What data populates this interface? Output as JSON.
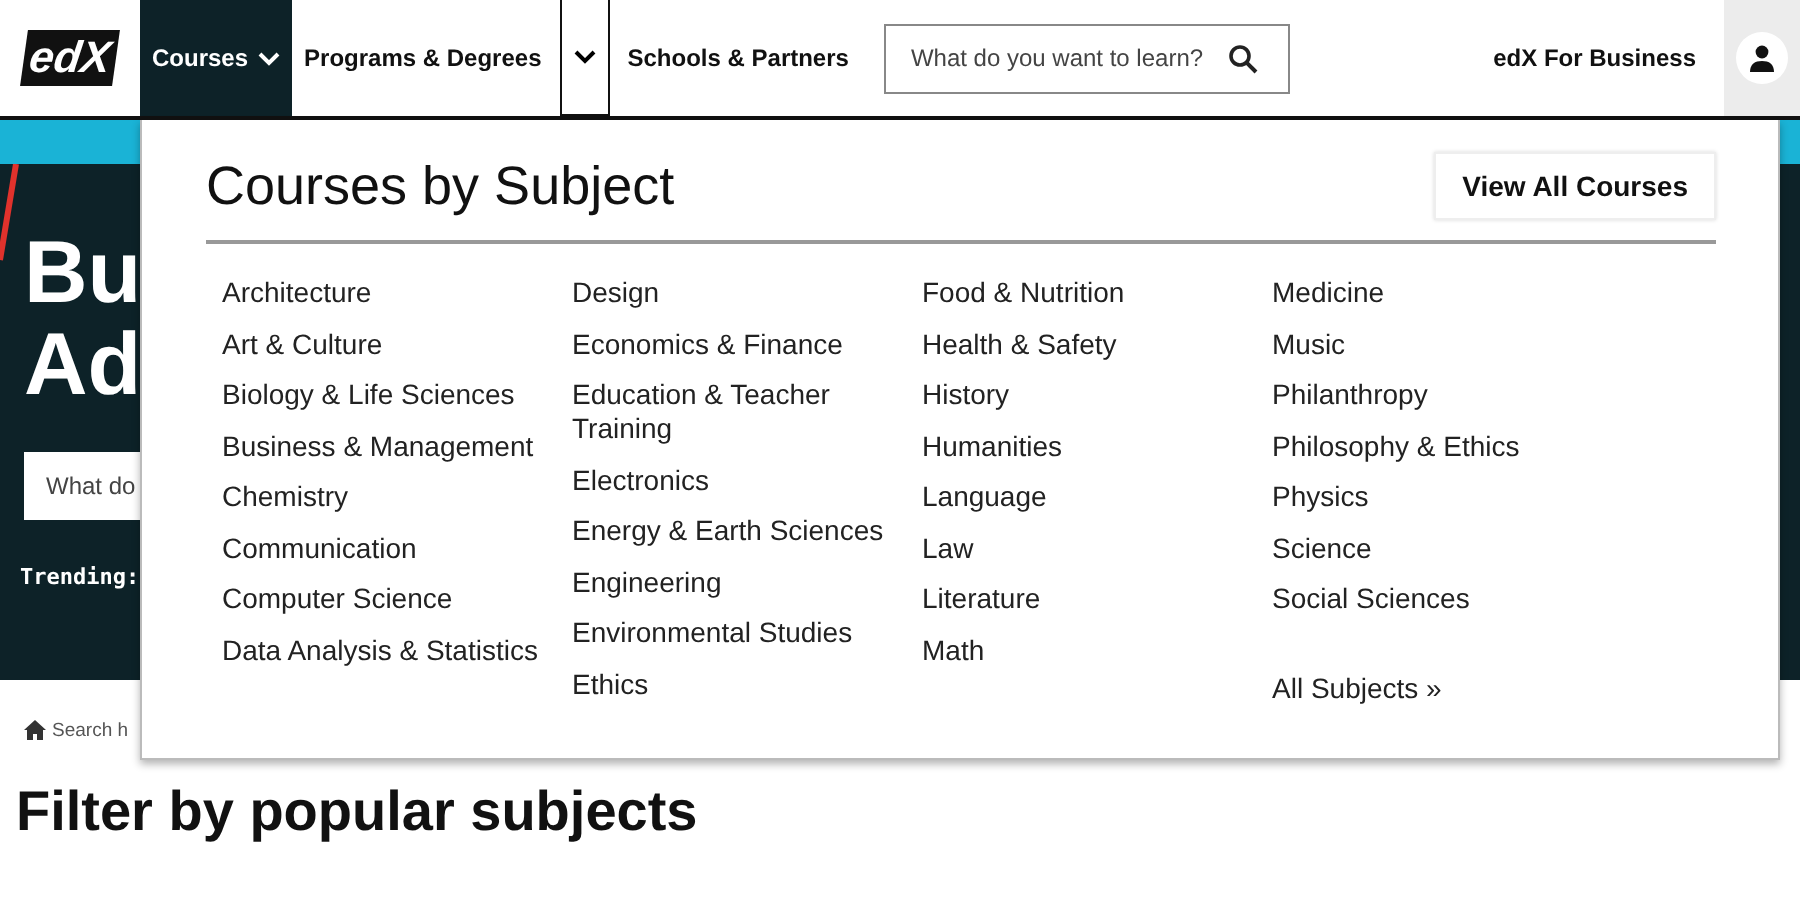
{
  "header": {
    "logo": "edX",
    "nav": [
      {
        "label": "Courses",
        "kind": "dropdown",
        "selected": true
      },
      {
        "label": "Programs & Degrees",
        "kind": "split",
        "selected": false
      },
      {
        "label": "Schools & Partners",
        "kind": "link",
        "selected": false
      }
    ],
    "search": {
      "placeholder": "What do you want to learn?"
    },
    "business_link": "edX For Business"
  },
  "hero": {
    "title_lines": [
      "Bu",
      "Ad"
    ],
    "search": {
      "placeholder": "What do"
    },
    "trending_label": "Trending:"
  },
  "menu": {
    "title": "Courses by Subject",
    "view_all_button": "View All Courses",
    "columns": [
      [
        "Architecture",
        "Art & Culture",
        "Biology & Life Sciences",
        "Business & Management",
        "Chemistry",
        "Communication",
        "Computer Science",
        "Data Analysis & Statistics"
      ],
      [
        "Design",
        "Economics & Finance",
        "Education & Teacher Training",
        "Electronics",
        "Energy & Earth Sciences",
        "Engineering",
        "Environmental Studies",
        "Ethics"
      ],
      [
        "Food & Nutrition",
        "Health & Safety",
        "History",
        "Humanities",
        "Language",
        "Law",
        "Literature",
        "Math"
      ],
      [
        "Medicine",
        "Music",
        "Philanthropy",
        "Philosophy & Ethics",
        "Physics",
        "Science",
        "Social Sciences"
      ]
    ],
    "all_subjects_link": "All Subjects »"
  },
  "breadcrumb": "Search h",
  "section_heading": "Filter by popular subjects"
}
